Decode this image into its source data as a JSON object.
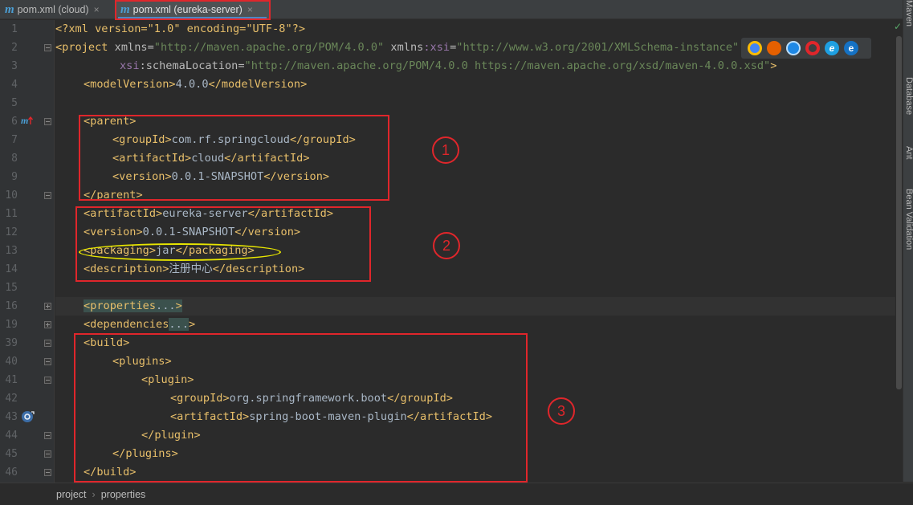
{
  "tabs": [
    {
      "icon": "m",
      "label": "pom.xml (cloud)",
      "close": "×"
    },
    {
      "icon": "m",
      "label": "pom.xml (eureka-server)",
      "close": "×"
    }
  ],
  "line_numbers": [
    "1",
    "2",
    "3",
    "4",
    "5",
    "6",
    "7",
    "8",
    "9",
    "10",
    "11",
    "12",
    "13",
    "14",
    "15",
    "16",
    "19",
    "39",
    "40",
    "41",
    "42",
    "43",
    "44",
    "45",
    "46"
  ],
  "code": {
    "l1_decl": "<?xml version=\"1.0\" encoding=\"UTF-8\"?>",
    "project_open": "<project",
    "xmlns_attr": "xmlns",
    "xmlns_val": "\"http://maven.apache.org/POM/4.0.0\"",
    "xmlns_xsi_prefix": "xmlns",
    "xsi_ns": ":xsi",
    "xsi_val": "\"http://www.w3.org/2001/XMLSchema-instance\"",
    "xsi": "xsi",
    "schema_attr": ":schemaLocation",
    "schema_val": "\"http://maven.apache.org/POM/4.0.0 https://maven.apache.org/xsd/maven-4.0.0.xsd\"",
    "gt": ">",
    "model_open": "<modelVersion>",
    "model_val": "4.0.0",
    "model_close": "</modelVersion>",
    "parent_open": "<parent>",
    "groupId_open": "<groupId>",
    "parent_group": "com.rf.springcloud",
    "groupId_close": "</groupId>",
    "artifactId_open": "<artifactId>",
    "parent_artifact": "cloud",
    "artifactId_close": "</artifactId>",
    "version_open": "<version>",
    "parent_version": "0.0.1-SNAPSHOT",
    "version_close": "</version>",
    "parent_close": "</parent>",
    "artifact": "eureka-server",
    "version": "0.0.1-SNAPSHOT",
    "packaging_open": "<packaging>",
    "packaging": "jar",
    "packaging_close": "</packaging>",
    "description_open": "<description>",
    "description": "注册中心",
    "description_close": "</description>",
    "properties_open": "<properties",
    "fold_dots": "...",
    "dependencies_open": "<dependencies",
    "build_open": "<build>",
    "plugins_open": "<plugins>",
    "plugin_open": "<plugin>",
    "plugin_group": "org.springframework.boot",
    "plugin_artifact": "spring-boot-maven-plugin",
    "plugin_close": "</plugin>",
    "plugins_close": "</plugins>",
    "build_close": "</build>"
  },
  "annotations": [
    "1",
    "2",
    "3"
  ],
  "browser_icons": [
    "chrome-icon",
    "firefox-icon",
    "safari-icon",
    "opera-icon",
    "ie-icon",
    "edge-icon"
  ],
  "right_tools": [
    "Maven",
    "Database",
    "Ant",
    "Bean Validation"
  ],
  "breadcrumb": [
    "project",
    "properties"
  ],
  "colors": {
    "tag": "#e8bf6a",
    "value": "#6a8759",
    "annotation": "#e0262b",
    "highlight": "#e8e600"
  }
}
